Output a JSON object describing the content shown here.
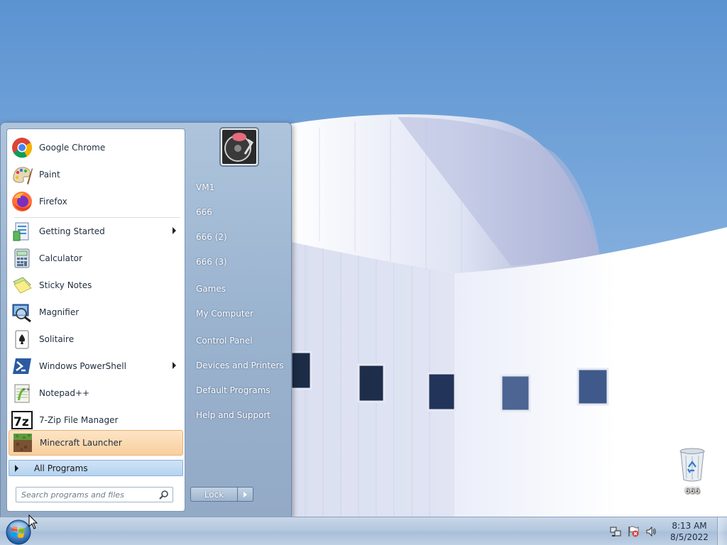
{
  "desktop": {
    "recycle_bin_label": "666",
    "wallpaper": {
      "sky_color": "#6fa2d6",
      "building_color": "#e8ecf6"
    }
  },
  "start_menu": {
    "pinned": [
      {
        "label": "Google Chrome",
        "icon": "chrome-icon"
      },
      {
        "label": "Paint",
        "icon": "paint-icon"
      },
      {
        "label": "Firefox",
        "icon": "firefox-icon"
      }
    ],
    "recent": [
      {
        "label": "Getting Started",
        "icon": "getting-started-icon",
        "submenu": true
      },
      {
        "label": "Calculator",
        "icon": "calculator-icon",
        "submenu": false
      },
      {
        "label": "Sticky Notes",
        "icon": "sticky-notes-icon",
        "submenu": false
      },
      {
        "label": "Magnifier",
        "icon": "magnifier-icon",
        "submenu": false
      },
      {
        "label": "Solitaire",
        "icon": "solitaire-icon",
        "submenu": false
      },
      {
        "label": "Windows PowerShell",
        "icon": "powershell-icon",
        "submenu": true
      },
      {
        "label": "Notepad++",
        "icon": "notepadpp-icon",
        "submenu": false
      },
      {
        "label": "7-Zip File Manager",
        "icon": "7zip-icon",
        "submenu": false
      },
      {
        "label": "Minecraft Launcher",
        "icon": "minecraft-icon",
        "submenu": false,
        "highlighted": true
      }
    ],
    "all_programs_label": "All Programs",
    "search_placeholder": "Search programs and files",
    "right_items": [
      {
        "label": "VM1"
      },
      {
        "label": "666"
      },
      {
        "label": "666 (2)"
      },
      {
        "label": "666 (3)"
      },
      {
        "label": "Games"
      },
      {
        "label": "My Computer"
      },
      {
        "label": "Control Panel"
      },
      {
        "label": "Devices and Printers"
      },
      {
        "label": "Default Programs"
      },
      {
        "label": "Help and Support"
      }
    ],
    "lock_label": "Lock",
    "highlight_color": "#f9cf9d"
  },
  "taskbar": {
    "clock_time": "8:13 AM",
    "clock_date": "8/5/2022",
    "tray_icons": [
      "network-icon",
      "action-center-flag-icon",
      "volume-icon"
    ]
  }
}
